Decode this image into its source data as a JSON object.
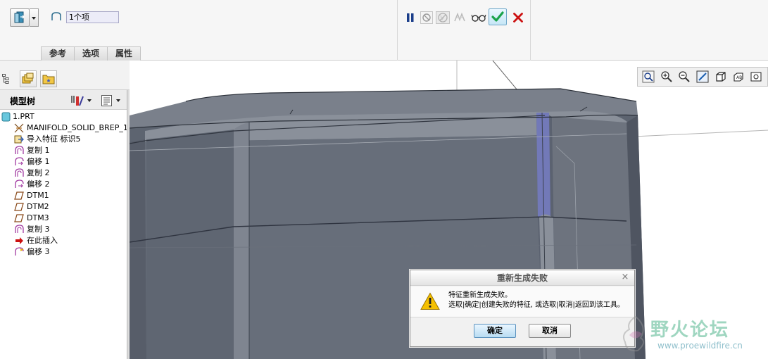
{
  "dashboard": {
    "collector_value": "1个项",
    "tabs": [
      "参考",
      "选项",
      "属性"
    ],
    "toolbar_icons": [
      "pause-icon",
      "no-geometry-preview-icon",
      "disabled-preview-icon",
      "verify-preview-icon",
      "glasses-preview-icon",
      "confirm-check-icon",
      "cancel-x-icon"
    ]
  },
  "model_tree": {
    "title": "模型树",
    "items": [
      {
        "label": "1.PRT",
        "icon": "part-icon",
        "indent": 0
      },
      {
        "label": "MANIFOLD_SOLID_BREP_1",
        "icon": "solid-brep-icon",
        "indent": 1
      },
      {
        "label": "导入特征 标识5",
        "icon": "import-feature-icon",
        "indent": 1
      },
      {
        "label": "复制 1",
        "icon": "copy-surface-icon",
        "indent": 1
      },
      {
        "label": "偏移 1",
        "icon": "offset-surface-icon",
        "indent": 1
      },
      {
        "label": "复制 2",
        "icon": "copy-surface-icon",
        "indent": 1
      },
      {
        "label": "偏移 2",
        "icon": "offset-surface-icon",
        "indent": 1
      },
      {
        "label": "DTM1",
        "icon": "datum-plane-icon",
        "indent": 1
      },
      {
        "label": "DTM2",
        "icon": "datum-plane-icon",
        "indent": 1
      },
      {
        "label": "DTM3",
        "icon": "datum-plane-icon",
        "indent": 1
      },
      {
        "label": "复制 3",
        "icon": "copy-surface-icon",
        "indent": 1
      },
      {
        "label": "在此插入",
        "icon": "insert-here-arrow-icon",
        "indent": 1
      },
      {
        "label": "偏移 3",
        "icon": "offset-surface-icon",
        "indent": 1
      }
    ]
  },
  "view_toolbar": {
    "icons": [
      "refit-icon",
      "zoom-in-icon",
      "zoom-out-icon",
      "repaint-icon",
      "display-style-icon",
      "view-manager-icon",
      "saved-views-icon"
    ]
  },
  "dialog": {
    "title": "重新生成失败",
    "message_line1": "特征重新生成失败。",
    "message_line2": "选取|确定|创建失败的特征, 或选取|取消|返回到该工具。",
    "ok_label": "确定",
    "cancel_label": "取消",
    "close_glyph": "×"
  },
  "watermark": {
    "text": "野火论坛",
    "url": "www.proewildfire.cn"
  },
  "colors": {
    "model_dark": "#5d6470",
    "model_mid": "#676e7a",
    "model_light": "#7c828d",
    "highlight_blue": "#7279b8",
    "accept_green": "#1aa34a",
    "cancel_red": "#cc1111"
  }
}
